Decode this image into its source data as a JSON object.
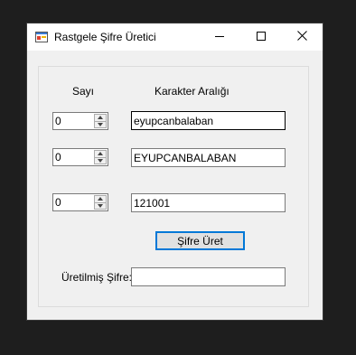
{
  "window": {
    "title": "Rastgele Şifre Üretici",
    "icons": {
      "app": "app-icon",
      "minimize": "minimize-icon",
      "maximize": "maximize-icon",
      "close": "close-icon"
    }
  },
  "form": {
    "count_header": "Sayı",
    "range_header": "Karakter Aralığı",
    "rows": [
      {
        "count": "0",
        "chars": "eyupcanbalaban"
      },
      {
        "count": "0",
        "chars": "EYUPCANBALABAN"
      },
      {
        "count": "0",
        "chars": "121001"
      }
    ],
    "generate_label": "Şifre Üret",
    "result_label": "Üretilmiş Şifre:",
    "result_value": ""
  },
  "colors": {
    "focus_border": "#0078d7",
    "window_bg": "#f0f0f0"
  }
}
